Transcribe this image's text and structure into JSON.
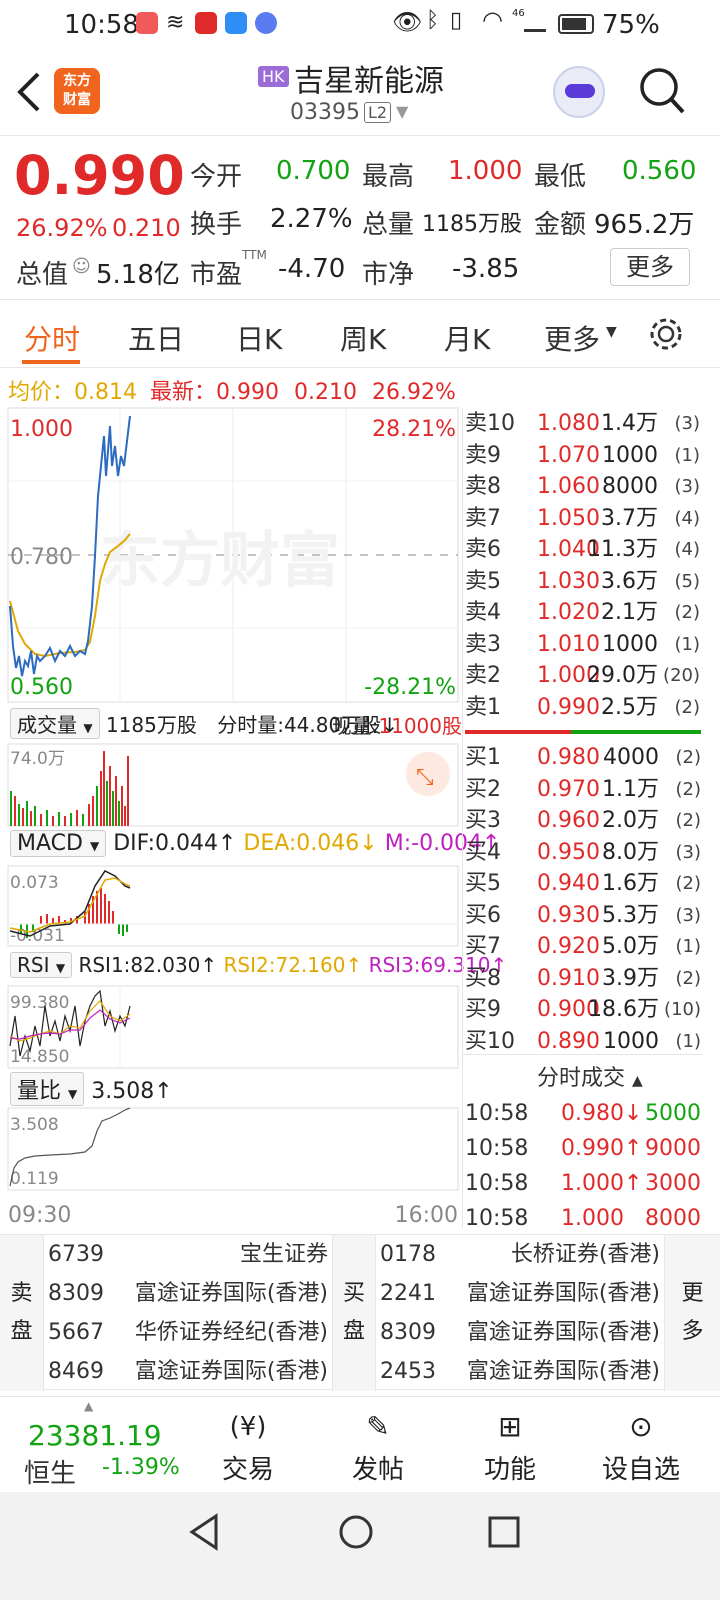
{
  "status": {
    "time": "10:58",
    "battery": "75%",
    "signal": "46"
  },
  "header": {
    "market_badge": "HK",
    "stock_name": "吉星新能源",
    "stock_code": "03395",
    "level": "L2",
    "app_logo": "东方\n财富"
  },
  "quote": {
    "price": "0.990",
    "change_pct": "26.92%",
    "change": "0.210",
    "open_label": "今开",
    "open": "0.700",
    "high_label": "最高",
    "high": "1.000",
    "low_label": "最低",
    "low": "0.560",
    "turnover_label": "换手",
    "turnover": "2.27%",
    "volume_label": "总量",
    "volume": "1185万股",
    "amount_label": "金额",
    "amount": "965.2万",
    "mcap_label": "总值",
    "mcap": "5.18亿",
    "pe_label": "市盈",
    "pe_sup": "TTM",
    "pe": "-4.70",
    "pb_label": "市净",
    "pb": "-3.85",
    "more_button": "更多"
  },
  "tabs": [
    "分时",
    "五日",
    "日K",
    "周K",
    "月K",
    "更多"
  ],
  "active_tab": 0,
  "intraday": {
    "avg_label": "均价：",
    "avg": "0.814",
    "latest_label": "最新：",
    "latest": "0.990",
    "latest_change": "0.210",
    "latest_pct": "26.92%",
    "y_high": "1.000",
    "y_mid": "0.780",
    "y_low": "0.560",
    "pct_high": "28.21%",
    "pct_low": "-28.21%",
    "watermark": "东方财富",
    "time_start": "09:30",
    "time_end": "16:00"
  },
  "volume_panel": {
    "selector": "成交量",
    "total": "1185万股",
    "minute_vol": "分时量:44.80万股↓",
    "cur_label": "现量:",
    "cur_value": "11000股",
    "max": "74.0万"
  },
  "macd_panel": {
    "selector": "MACD",
    "dif": "DIF:0.044↑",
    "dea": "DEA:0.046↓",
    "m": "M:-0.004↑",
    "top": "0.073",
    "bottom": "-0.031"
  },
  "rsi_panel": {
    "selector": "RSI",
    "rsi1": "RSI1:82.030↑",
    "rsi2": "RSI2:72.160↑",
    "rsi3": "RSI3:69.310↑",
    "top": "99.380",
    "bottom": "14.850"
  },
  "vr_panel": {
    "selector": "量比",
    "value": "3.508↑",
    "top": "3.508",
    "bottom": "0.119"
  },
  "asks": [
    {
      "label": "卖10",
      "price": "1.080",
      "vol": "1.4万",
      "cnt": "(3)"
    },
    {
      "label": "卖9",
      "price": "1.070",
      "vol": "1000",
      "cnt": "(1)"
    },
    {
      "label": "卖8",
      "price": "1.060",
      "vol": "8000",
      "cnt": "(3)"
    },
    {
      "label": "卖7",
      "price": "1.050",
      "vol": "3.7万",
      "cnt": "(4)"
    },
    {
      "label": "卖6",
      "price": "1.040",
      "vol": "11.3万",
      "cnt": "(4)"
    },
    {
      "label": "卖5",
      "price": "1.030",
      "vol": "3.6万",
      "cnt": "(5)"
    },
    {
      "label": "卖4",
      "price": "1.020",
      "vol": "2.1万",
      "cnt": "(2)"
    },
    {
      "label": "卖3",
      "price": "1.010",
      "vol": "1000",
      "cnt": "(1)"
    },
    {
      "label": "卖2",
      "price": "1.000",
      "vol": "29.0万",
      "cnt": "(20)"
    },
    {
      "label": "卖1",
      "price": "0.990",
      "vol": "2.5万",
      "cnt": "(2)"
    }
  ],
  "bids": [
    {
      "label": "买1",
      "price": "0.980",
      "vol": "4000",
      "cnt": "(2)"
    },
    {
      "label": "买2",
      "price": "0.970",
      "vol": "1.1万",
      "cnt": "(2)"
    },
    {
      "label": "买3",
      "price": "0.960",
      "vol": "2.0万",
      "cnt": "(2)"
    },
    {
      "label": "买4",
      "price": "0.950",
      "vol": "8.0万",
      "cnt": "(3)"
    },
    {
      "label": "买5",
      "price": "0.940",
      "vol": "1.6万",
      "cnt": "(2)"
    },
    {
      "label": "买6",
      "price": "0.930",
      "vol": "5.3万",
      "cnt": "(3)"
    },
    {
      "label": "买7",
      "price": "0.920",
      "vol": "5.0万",
      "cnt": "(1)"
    },
    {
      "label": "买8",
      "price": "0.910",
      "vol": "3.9万",
      "cnt": "(2)"
    },
    {
      "label": "买9",
      "price": "0.900",
      "vol": "18.6万",
      "cnt": "(10)"
    },
    {
      "label": "买10",
      "price": "0.890",
      "vol": "1000",
      "cnt": "(1)"
    }
  ],
  "ticks_title": "分时成交",
  "ticks": [
    {
      "time": "10:58",
      "price": "0.980↓",
      "vol": "5000",
      "dir": "down"
    },
    {
      "time": "10:58",
      "price": "0.990↑",
      "vol": "9000",
      "dir": "up"
    },
    {
      "time": "10:58",
      "price": "1.000↑",
      "vol": "3000",
      "dir": "up"
    },
    {
      "time": "10:58",
      "price": "1.000",
      "vol": "8000",
      "dir": "up"
    }
  ],
  "broker": {
    "sell_label": "卖\n盘",
    "buy_label": "买\n盘",
    "more_label": "更\n多",
    "sell": [
      {
        "code": "6739",
        "name": "宝生证券"
      },
      {
        "code": "8309",
        "name": "富途证券国际(香港)"
      },
      {
        "code": "5667",
        "name": "华侨证券经纪(香港)"
      },
      {
        "code": "8469",
        "name": "富途证券国际(香港)"
      }
    ],
    "buy": [
      {
        "code": "0178",
        "name": "长桥证券(香港)"
      },
      {
        "code": "2241",
        "name": "富途证券国际(香港)"
      },
      {
        "code": "8309",
        "name": "富途证券国际(香港)"
      },
      {
        "code": "2453",
        "name": "富途证券国际(香港)"
      }
    ]
  },
  "bottom": {
    "index_value": "23381.19",
    "index_name": "恒生",
    "index_change": "-1.39%",
    "trade": "交易",
    "post": "发帖",
    "function": "功能",
    "watchlist": "设自选"
  },
  "colors": {
    "up": "#e02a2a",
    "down": "#12a312",
    "accent": "#f0641e",
    "price_line": "#2c6bbf",
    "avg_line": "#e0a800"
  }
}
